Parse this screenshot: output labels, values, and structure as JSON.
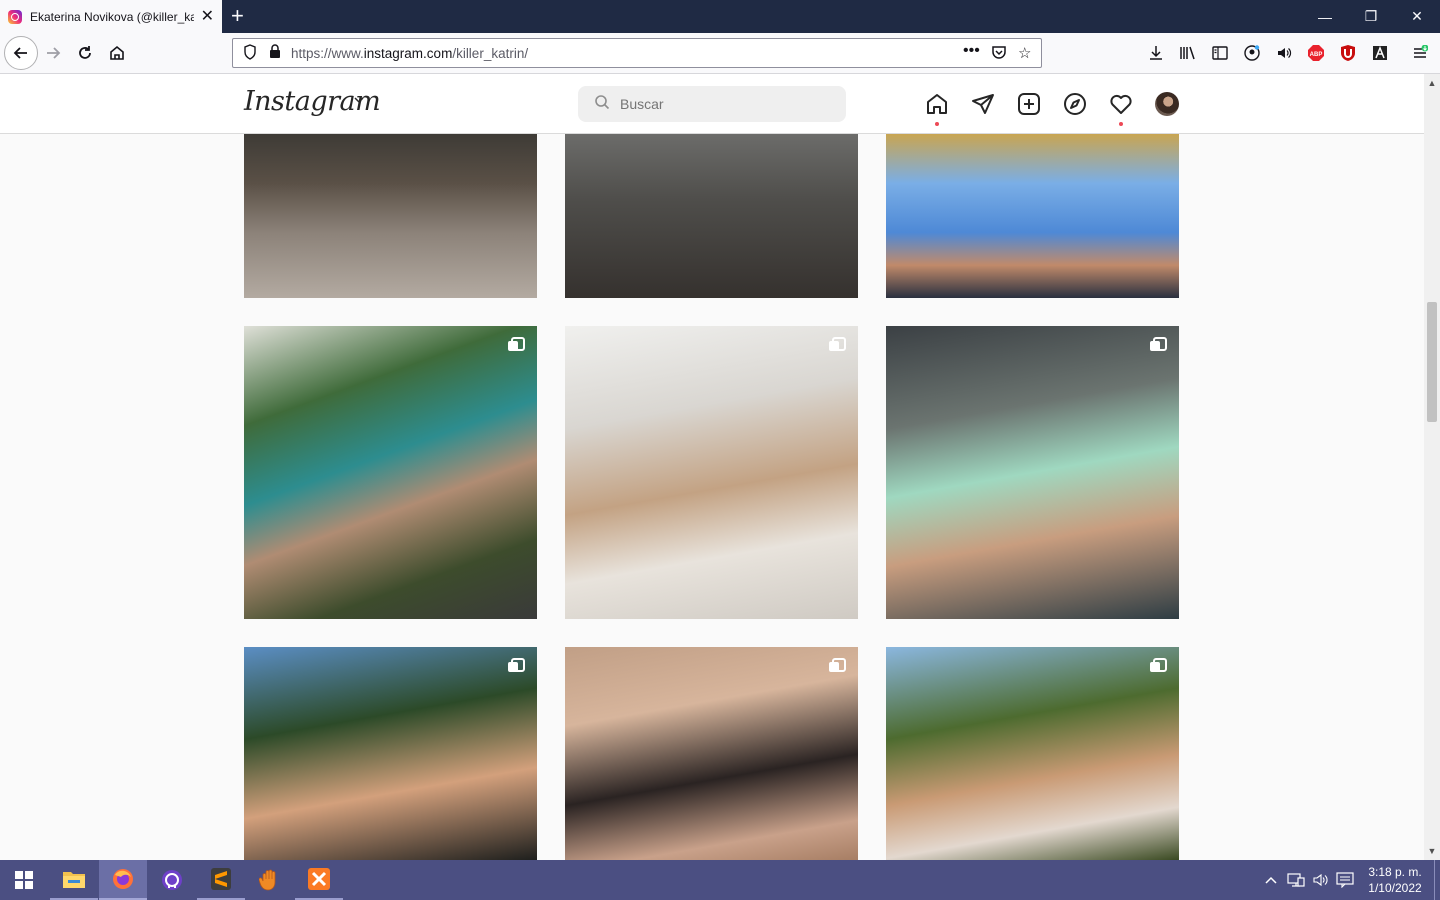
{
  "browser": {
    "tab_title": "Ekaterina Novikova (@killer_kat",
    "url_prefix": "https://www.",
    "url_domain": "instagram.com",
    "url_path": "/killer_katrin/"
  },
  "instagram": {
    "logo_text": "Instagram",
    "search_placeholder": "Buscar"
  },
  "grid": {
    "photos": [
      {
        "row": 1,
        "col": 1,
        "carousel": false
      },
      {
        "row": 1,
        "col": 2,
        "carousel": false
      },
      {
        "row": 1,
        "col": 3,
        "carousel": false
      },
      {
        "row": 2,
        "col": 1,
        "carousel": true
      },
      {
        "row": 2,
        "col": 2,
        "carousel": true
      },
      {
        "row": 2,
        "col": 3,
        "carousel": true
      },
      {
        "row": 3,
        "col": 1,
        "carousel": true
      },
      {
        "row": 3,
        "col": 2,
        "carousel": true
      },
      {
        "row": 3,
        "col": 3,
        "carousel": true
      }
    ]
  },
  "taskbar": {
    "clock_time": "3:18 p. m.",
    "clock_date": "1/10/2022"
  },
  "colors": {
    "tabbar_bg": "#1f2a44",
    "taskbar_bg": "#4b4f82",
    "notification_dot": "#ed4956"
  }
}
